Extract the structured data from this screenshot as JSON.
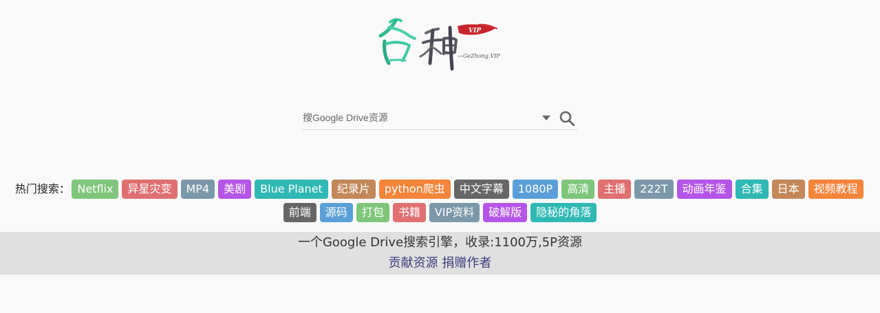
{
  "logo": {
    "main_text": "各种",
    "badge_text": "VIP",
    "sub_text": "—GeZhong.VIP"
  },
  "search": {
    "placeholder": "搜Google Drive资源",
    "value": ""
  },
  "hot_search": {
    "label": "热门搜索：",
    "tags": [
      {
        "text": "Netflix",
        "color": "#7fc67b"
      },
      {
        "text": "异星灾变",
        "color": "#e07070"
      },
      {
        "text": "MP4",
        "color": "#7b98aa"
      },
      {
        "text": "美剧",
        "color": "#b455e8"
      },
      {
        "text": "Blue Planet",
        "color": "#2fb8b4"
      },
      {
        "text": "纪录片",
        "color": "#c4875a"
      },
      {
        "text": "python爬虫",
        "color": "#f5853a"
      },
      {
        "text": "中文字幕",
        "color": "#666666"
      },
      {
        "text": "1080P",
        "color": "#5b9fd8"
      },
      {
        "text": "高清",
        "color": "#7fc67b"
      },
      {
        "text": "主播",
        "color": "#e07070"
      },
      {
        "text": "222T",
        "color": "#7b98aa"
      },
      {
        "text": "动画年鉴",
        "color": "#b455e8"
      },
      {
        "text": "合集",
        "color": "#2fb8b4"
      },
      {
        "text": "日本",
        "color": "#c4875a"
      },
      {
        "text": "视频教程",
        "color": "#f5853a"
      },
      {
        "text": "前端",
        "color": "#666666"
      },
      {
        "text": "源码",
        "color": "#5b9fd8"
      },
      {
        "text": "打包",
        "color": "#7fc67b"
      },
      {
        "text": "书籍",
        "color": "#e07070"
      },
      {
        "text": "VIP资料",
        "color": "#7b98aa"
      },
      {
        "text": "破解版",
        "color": "#b455e8"
      },
      {
        "text": "隐秘的角落",
        "color": "#2fb8b4"
      }
    ]
  },
  "footer": {
    "stat": "一个Google Drive搜索引擎，收录:1100万,5P资源",
    "links": [
      "贡献资源",
      "捐赠作者"
    ]
  }
}
